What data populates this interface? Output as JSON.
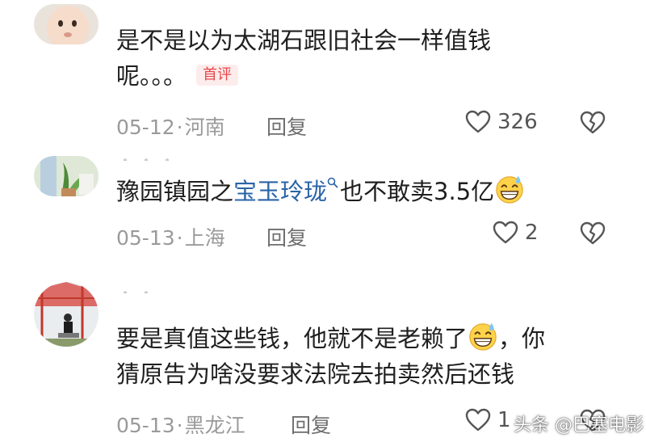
{
  "comments": [
    {
      "username": "・・・・",
      "text_line1": "是不是以为太湖石跟旧社会一样值钱",
      "text_line2": "呢。。。",
      "badge": "首评",
      "date": "05-12",
      "location": "河南",
      "reply_label": "回复",
      "likes": "326"
    },
    {
      "username": "・・・",
      "text_before": "豫园镇园之",
      "text_link": "宝玉玲珑",
      "text_after": "也不敢卖3.5亿",
      "date": "05-13",
      "location": "上海",
      "reply_label": "回复",
      "likes": "2"
    },
    {
      "username": "・・",
      "text_line1_before": "要是真值这些钱，他就不是老赖了",
      "text_line1_after": "，你",
      "text_line2": "猜原告为啥没要求法院去拍卖然后还钱",
      "date": "05-13",
      "location": "黑龙江",
      "reply_label": "回复",
      "likes": "1"
    }
  ],
  "separator": "·",
  "watermark": "头条 @巴塞电影",
  "icons": {
    "like": "heart-outline-icon",
    "dislike": "broken-heart-icon",
    "search": "search-icon",
    "emoji": "grinning-sweat-emoji-icon"
  },
  "colors": {
    "link": "#2a64a8",
    "badge_text": "#e8474a",
    "badge_bg": "#fdecec",
    "meta": "#9a9a9a"
  }
}
